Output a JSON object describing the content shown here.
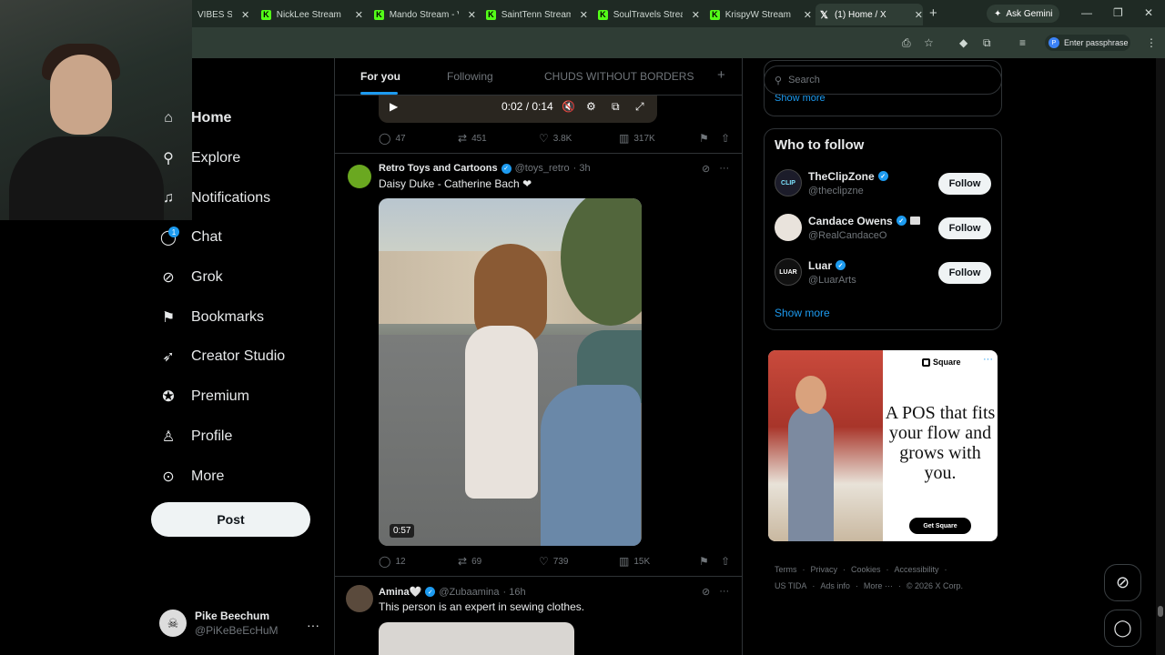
{
  "browser": {
    "tabs": [
      {
        "label": "VIBES Stre",
        "icon": "kick-icon"
      },
      {
        "label": "NickLee Stream",
        "icon": "kick-icon"
      },
      {
        "label": "Mando Stream - V",
        "icon": "kick-icon"
      },
      {
        "label": "SaintTenn Stream",
        "icon": "kick-icon"
      },
      {
        "label": "SoulTravels Strea",
        "icon": "kick-icon"
      },
      {
        "label": "KrispyW Stream",
        "icon": "kick-icon"
      },
      {
        "label": "(1) Home / X",
        "icon": "x-icon",
        "active": true
      }
    ],
    "ask_gemini": "Ask Gemini",
    "profile_label": "Enter passphrase",
    "profile_initial": "P"
  },
  "sidebar": {
    "items": [
      {
        "label": "Home",
        "icon": "home-icon"
      },
      {
        "label": "Explore",
        "icon": "search-icon"
      },
      {
        "label": "Notifications",
        "icon": "bell-icon"
      },
      {
        "label": "Chat",
        "icon": "chat-icon",
        "badge": "1"
      },
      {
        "label": "Grok",
        "icon": "grok-icon"
      },
      {
        "label": "Bookmarks",
        "icon": "bookmark-icon"
      },
      {
        "label": "Creator Studio",
        "icon": "rocket-icon"
      },
      {
        "label": "Premium",
        "icon": "premium-icon"
      },
      {
        "label": "Profile",
        "icon": "person-icon"
      },
      {
        "label": "More",
        "icon": "more-icon"
      }
    ],
    "post_label": "Post",
    "account": {
      "name": "Pike Beechum",
      "handle": "@PiKeBeEcHuM"
    }
  },
  "feed": {
    "tabs": [
      "For you",
      "Following",
      "CHUDS WITHOUT BORDERS"
    ],
    "prev_video": {
      "time": "0:02 / 0:14"
    },
    "prev_stats": {
      "replies": "47",
      "reposts": "451",
      "likes": "3.8K",
      "views": "317K"
    },
    "tweet1": {
      "name": "Retro Toys and Cartoons",
      "handle": "@toys_retro",
      "time": "· 3h",
      "text": "Daisy Duke - Catherine Bach ❤",
      "duration": "0:57",
      "stats": {
        "replies": "12",
        "reposts": "69",
        "likes": "739",
        "views": "15K"
      }
    },
    "tweet2": {
      "name": "Amina🤍",
      "handle": "@Zubaamina",
      "time": "· 16h",
      "text": "This person is an expert in sewing clothes."
    }
  },
  "right": {
    "search_placeholder": "Search",
    "show_more_top": "Show more",
    "who_to_follow_title": "Who to follow",
    "follow_suggestions": [
      {
        "name": "TheClipZone",
        "handle": "@theclipzne",
        "button": "Follow"
      },
      {
        "name": "Candace Owens",
        "handle": "@RealCandaceO",
        "button": "Follow"
      },
      {
        "name": "Luar",
        "handle": "@LuarArts",
        "button": "Follow"
      }
    ],
    "show_more": "Show more",
    "ad": {
      "brand": "Square",
      "headline": "A POS that fits your flow and grows with you.",
      "cta": "Get Square"
    },
    "footer_row1": [
      "Terms",
      "·",
      "Privacy",
      "·",
      "Cookies",
      "·",
      "Accessibility",
      "·"
    ],
    "footer_row2": [
      "US TIDA",
      "·",
      "Ads info",
      "·",
      "More ···",
      "·",
      "© 2026 X Corp."
    ]
  }
}
